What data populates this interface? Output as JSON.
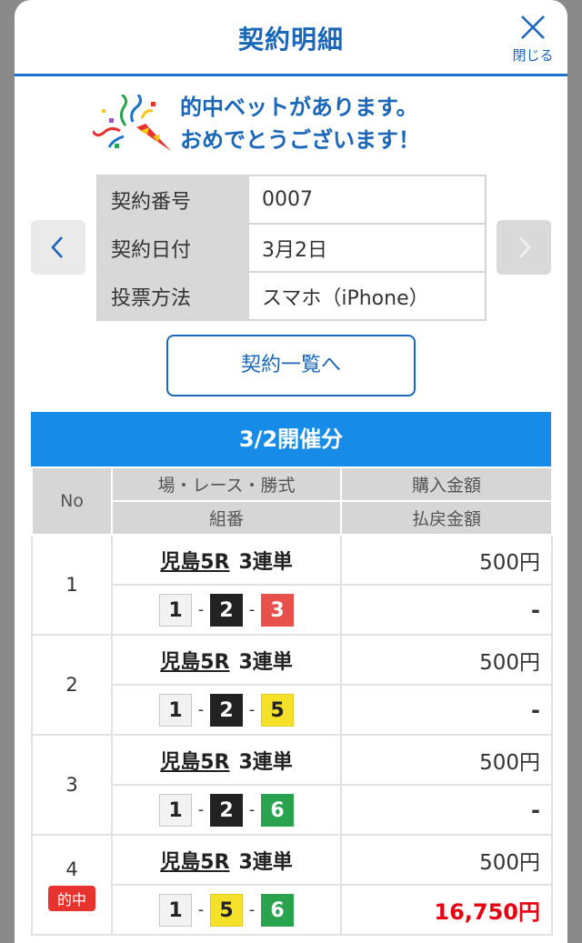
{
  "header": {
    "title": "契約明細",
    "close_label": "閉じる"
  },
  "congrats": {
    "line1": "的中ベットがあります。",
    "line2": "おめでとうございます！"
  },
  "contract": [
    {
      "key": "契約番号",
      "value": "0007"
    },
    {
      "key": "契約日付",
      "value": "3月2日"
    },
    {
      "key": "投票方法",
      "value": "スマホ（iPhone）"
    }
  ],
  "list_button": "契約一覧へ",
  "day_header": "3/2開催分",
  "table_headers": {
    "no": "No",
    "race": "場・レース・勝式",
    "combo": "組番",
    "purchase": "購入金額",
    "payout": "払戻金額"
  },
  "bets": [
    {
      "no": "1",
      "race": "児島5R",
      "type": "3連単",
      "combo": [
        "1",
        "2",
        "3"
      ],
      "amount": "500円",
      "payout": "-",
      "hit": false
    },
    {
      "no": "2",
      "race": "児島5R",
      "type": "3連単",
      "combo": [
        "1",
        "2",
        "5"
      ],
      "amount": "500円",
      "payout": "-",
      "hit": false
    },
    {
      "no": "3",
      "race": "児島5R",
      "type": "3連単",
      "combo": [
        "1",
        "2",
        "6"
      ],
      "amount": "500円",
      "payout": "-",
      "hit": false
    },
    {
      "no": "4",
      "race": "児島5R",
      "type": "3連単",
      "combo": [
        "1",
        "5",
        "6"
      ],
      "amount": "500円",
      "payout": "16,750円",
      "hit": true
    }
  ],
  "hit_label": "的中",
  "colors": {
    "accent": "#1a66b8",
    "header_bar": "#168ce8",
    "win": "#e60012"
  }
}
